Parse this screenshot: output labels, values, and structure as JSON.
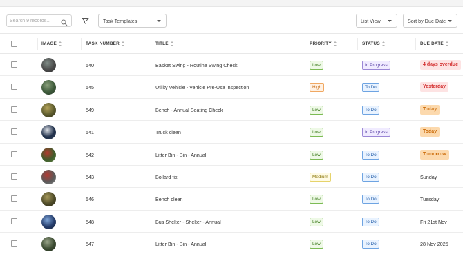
{
  "toolbar": {
    "search_placeholder": "Search 9 records...",
    "template_select": "Task Templates",
    "view_select": "List View",
    "sort_select": "Sort by Due Date"
  },
  "columns": {
    "image": "IMAGE",
    "task_number": "TASK NUMBER",
    "title": "TITLE",
    "priority": "PRIORITY",
    "status": "STATUS",
    "due_date": "DUE DATE"
  },
  "rows": [
    {
      "task_number": "540",
      "title": "Basket Swing - Routine Swing Check",
      "priority": "Low",
      "status": "In Progress",
      "due": "4 days overdue",
      "due_style": "overdue",
      "thumb": [
        "#4a4a4a",
        "#7f8b86",
        "#2f2f2f"
      ]
    },
    {
      "task_number": "545",
      "title": "Utility Vehicle - Vehicle Pre-Use Inspection",
      "priority": "High",
      "status": "To Do",
      "due": "Yesterday",
      "due_style": "overdue",
      "thumb": [
        "#3d5a3a",
        "#8aa07b",
        "#2a3a2a"
      ]
    },
    {
      "task_number": "549",
      "title": "Bench - Annual Seating Check",
      "priority": "Low",
      "status": "To Do",
      "due": "Today",
      "due_style": "orange",
      "thumb": [
        "#5b5a2d",
        "#b5a45a",
        "#2b2b17"
      ]
    },
    {
      "task_number": "541",
      "title": "Truck clean",
      "priority": "Low",
      "status": "In Progress",
      "due": "Today",
      "due_style": "orange",
      "thumb": [
        "#1f2f4a",
        "#d9dde3",
        "#39465c"
      ]
    },
    {
      "task_number": "542",
      "title": "Litter Bin - Bin - Annual",
      "priority": "Low",
      "status": "To Do",
      "due": "Tomorrow",
      "due_style": "orange",
      "thumb": [
        "#3e5c2b",
        "#b33a2e",
        "#6b8a4a"
      ]
    },
    {
      "task_number": "543",
      "title": "Bollard fix",
      "priority": "Medium",
      "status": "To Do",
      "due": "Sunday",
      "due_style": "plain",
      "thumb": [
        "#5a5a5a",
        "#b23a32",
        "#8a8a8a"
      ]
    },
    {
      "task_number": "546",
      "title": "Bench clean",
      "priority": "Low",
      "status": "To Do",
      "due": "Tuesday",
      "due_style": "plain",
      "thumb": [
        "#4d4a28",
        "#a6995a",
        "#2a2815"
      ]
    },
    {
      "task_number": "548",
      "title": "Bus Shelter - Shelter - Annual",
      "priority": "Low",
      "status": "To Do",
      "due": "Fri 21st Nov",
      "due_style": "plain",
      "thumb": [
        "#243c6b",
        "#7fa6d9",
        "#1a2233"
      ]
    },
    {
      "task_number": "547",
      "title": "Litter Bin - Bin - Annual",
      "priority": "Low",
      "status": "To Do",
      "due": "28 Nov 2025",
      "due_style": "plain",
      "thumb": [
        "#3a4a30",
        "#9aa58a",
        "#263020"
      ]
    }
  ],
  "colors": {
    "priority_low": "#7cbb54",
    "priority_high": "#f0a862",
    "priority_medium": "#e6d36b",
    "status_in_progress": "#9b87d6",
    "status_todo": "#6ea4e2",
    "due_overdue": "#d22a2a",
    "due_soon": "#fcd9ad"
  }
}
